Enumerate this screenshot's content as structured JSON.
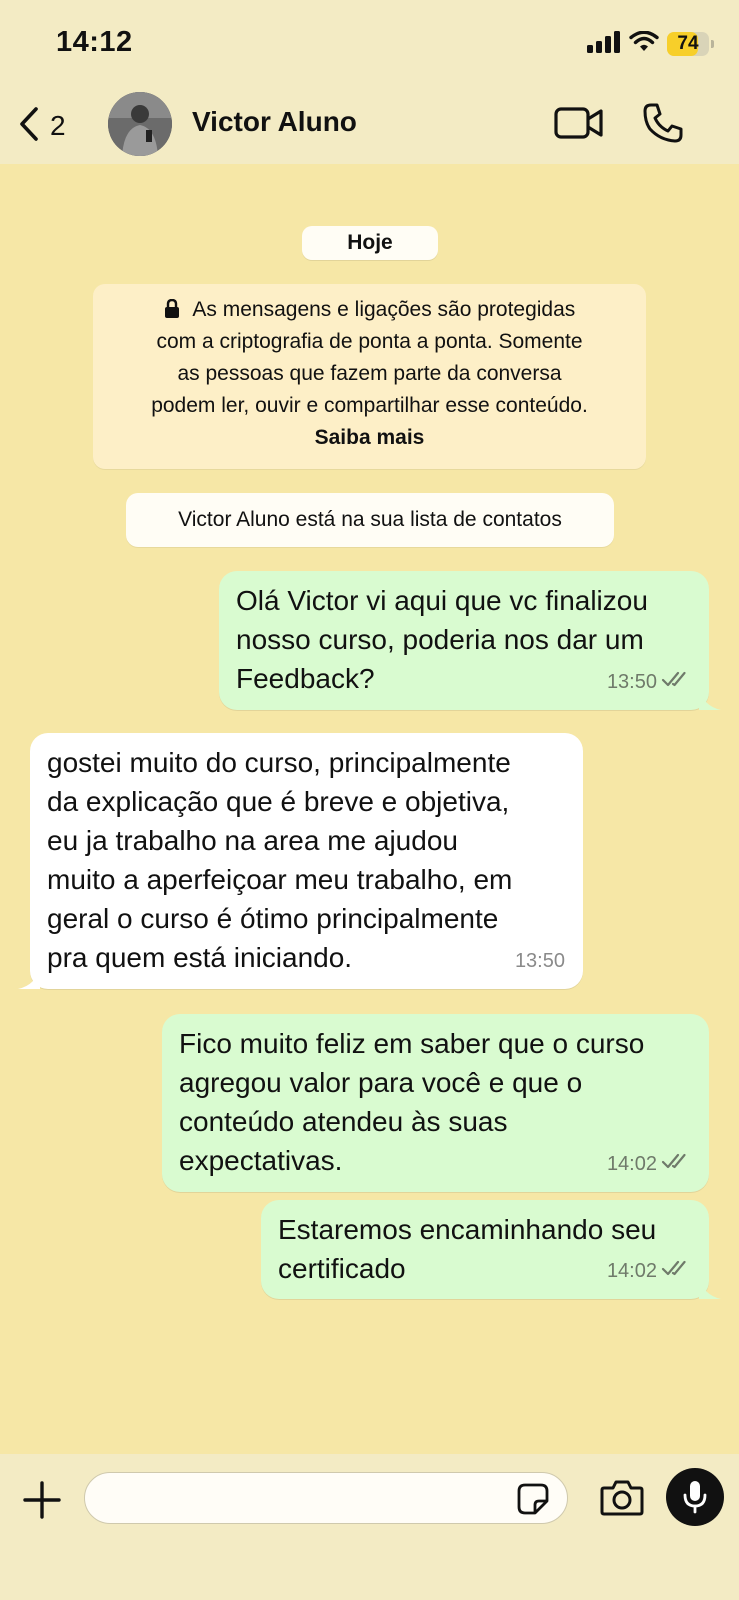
{
  "status_bar": {
    "time": "14:12",
    "battery": "74",
    "battery_percent": 74
  },
  "header": {
    "back_count": "2",
    "contact_name": "Victor Aluno"
  },
  "chat": {
    "date_label": "Hoje",
    "encryption_notice": "As mensagens e ligações são protegidas\ncom a criptografia de ponta a ponta. Somente\nas pessoas que fazem parte da conversa\npodem ler, ouvir e compartilhar esse conteúdo.",
    "learn_more": "Saiba mais",
    "contact_notice": "Victor Aluno está na sua lista de contatos",
    "messages": [
      {
        "direction": "out",
        "text": "Olá Victor vi aqui que vc finalizou\nnosso curso, poderia nos dar um\nFeedback?",
        "time": "13:50",
        "status": "read"
      },
      {
        "direction": "in",
        "text": "gostei muito do curso, principalmente\nda explicação que é breve e objetiva,\neu ja trabalho na area me ajudou\nmuito a aperfeiçoar meu trabalho, em\ngeral o curso é ótimo principalmente\npra quem está iniciando.",
        "time": "13:50"
      },
      {
        "direction": "out",
        "text": "Fico muito feliz em saber que o curso\nagregou valor para você e que o\nconteúdo atendeu às suas\nexpectativas.",
        "time": "14:02",
        "status": "read"
      },
      {
        "direction": "out",
        "text": "Estaremos encaminhando seu\ncertificado",
        "time": "14:02",
        "status": "read"
      }
    ]
  },
  "composer": {
    "placeholder": ""
  },
  "colors": {
    "background": "#f6e7a6",
    "outgoing": "#d9fbd0",
    "incoming": "#ffffff",
    "bar": "#f3ebc4"
  }
}
